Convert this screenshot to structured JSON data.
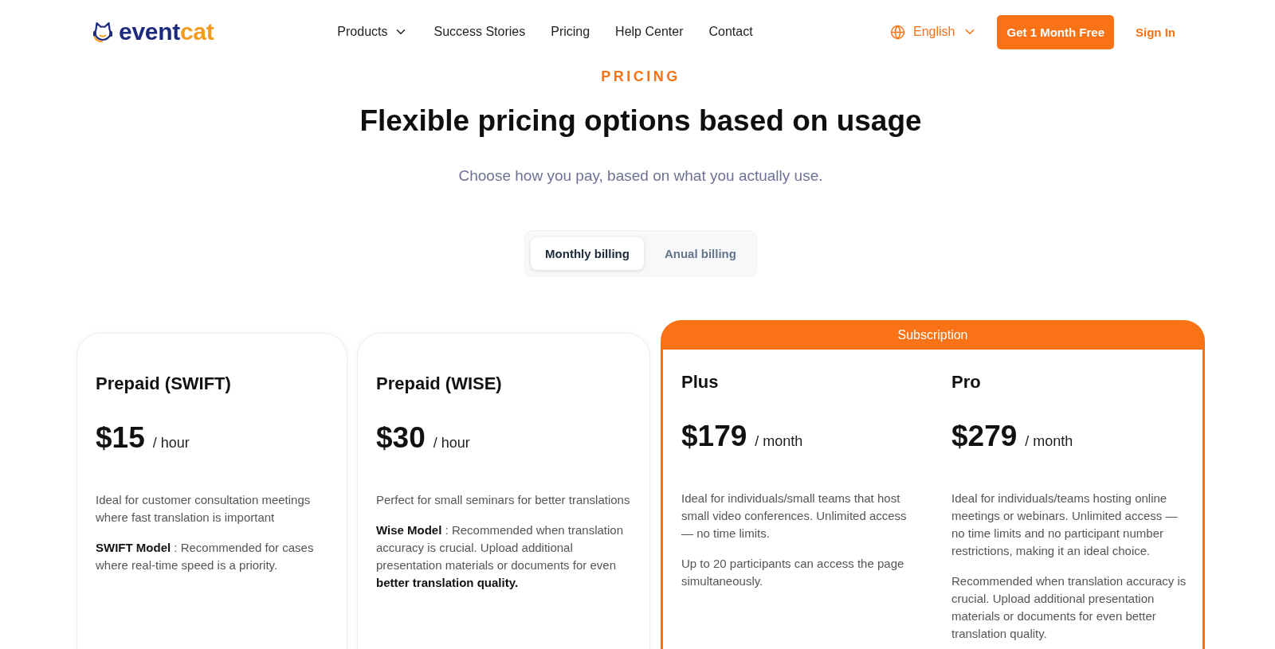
{
  "header": {
    "logo": [
      "event",
      "cat"
    ],
    "nav": [
      {
        "label": "Products",
        "has_menu": true
      },
      {
        "label": "Success Stories",
        "has_menu": false
      },
      {
        "label": "Pricing",
        "has_menu": false
      },
      {
        "label": "Help Center",
        "has_menu": false
      },
      {
        "label": "Contact",
        "has_menu": false
      }
    ],
    "language": {
      "label": "English",
      "has_menu": true
    },
    "cta_button": "Get 1 Month Free",
    "sign_in": "Sign In"
  },
  "hero": {
    "eyebrow": "PRICING",
    "title": "Flexible pricing options based on usage",
    "subtitle": "Choose how you pay, based on what you actually use."
  },
  "billing_toggle": [
    {
      "label": "Monthly billing",
      "selected": true
    },
    {
      "label": "Anual billing",
      "selected": false
    }
  ],
  "plans": [
    {
      "kind": "card",
      "name": "Prepaid (SWIFT)",
      "price": "$15",
      "unit": "/ hour",
      "paragraphs": [
        "Ideal for customer consultation meetings where fast translation is important",
        "**SWIFT Model** : Recommended for cases where real-time speed is a priority."
      ]
    },
    {
      "kind": "card",
      "name": "Prepaid (WISE)",
      "price": "$30",
      "unit": "/ hour",
      "paragraphs": [
        "Perfect for small seminars for better translations",
        "**Wise Model** : Recommended when translation accuracy is crucial. Upload additional presentation materials or documents for even **better translation quality.**"
      ]
    },
    {
      "kind": "group",
      "label": "Subscription",
      "plans": [
        {
          "name": "Plus",
          "price": "$179",
          "unit": "/ month",
          "paragraphs": [
            "Ideal for individuals/small teams that host small video conferences. Unlimited access — no time limits.",
            "Up to 20 participants can access the page simultaneously."
          ]
        },
        {
          "name": "Pro",
          "price": "$279",
          "unit": "/ month",
          "paragraphs": [
            "Ideal for individuals/teams hosting online meetings or webinars. Unlimited access — no time limits and no participant number restrictions, making it an ideal choice.",
            "Recommended when translation accuracy is crucial. Upload additional presentation materials or documents for even better translation quality."
          ]
        }
      ]
    }
  ]
}
